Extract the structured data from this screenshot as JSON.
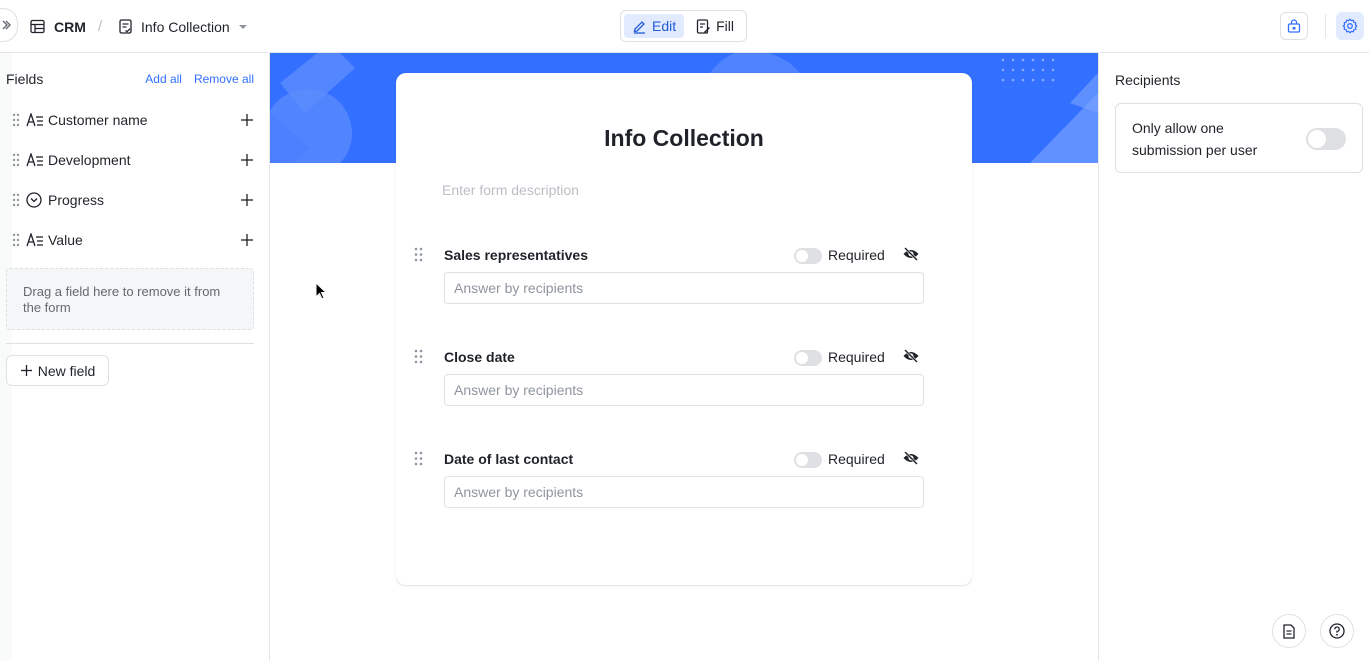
{
  "header": {
    "app_name": "CRM",
    "form_name": "Info Collection",
    "modes": [
      {
        "label": "Edit",
        "active": true
      },
      {
        "label": "Fill",
        "active": false
      }
    ]
  },
  "fields_panel": {
    "title": "Fields",
    "add_all": "Add all",
    "remove_all": "Remove all",
    "items": [
      {
        "label": "Customer name",
        "icon": "text-field-icon"
      },
      {
        "label": "Development",
        "icon": "text-field-icon"
      },
      {
        "label": "Progress",
        "icon": "single-select-icon"
      },
      {
        "label": "Value",
        "icon": "text-field-icon"
      }
    ],
    "drop_hint": "Drag a field here to remove it from the form",
    "new_field": "New field"
  },
  "form": {
    "title": "Info Collection",
    "description_placeholder": "Enter form description",
    "questions": [
      {
        "label": "Sales representatives",
        "required_label": "Required",
        "required": false,
        "placeholder": "Answer by recipients"
      },
      {
        "label": "Close date",
        "required_label": "Required",
        "required": false,
        "placeholder": "Answer by recipients"
      },
      {
        "label": "Date of last contact",
        "required_label": "Required",
        "required": false,
        "placeholder": "Answer by recipients"
      }
    ]
  },
  "settings_panel": {
    "title": "Recipients",
    "one_submission_label": "Only allow one submission per user",
    "one_submission_enabled": false
  },
  "colors": {
    "accent": "#3370ff",
    "banner": "#3370ff",
    "active_bg": "#e1eaff"
  }
}
